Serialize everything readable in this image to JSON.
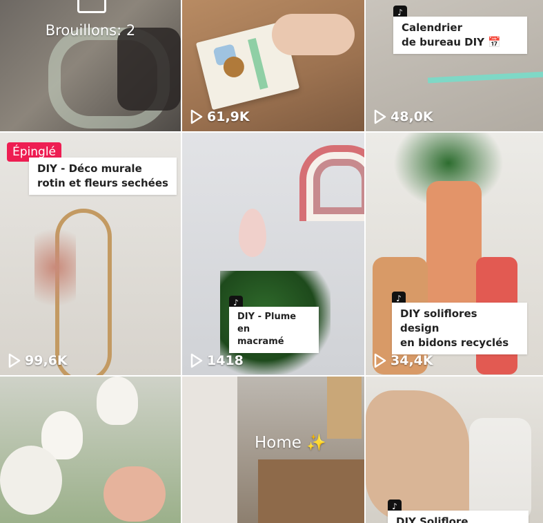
{
  "tiles": [
    {
      "kind": "drafts",
      "text": "Brouillons: 2"
    },
    {
      "kind": "video",
      "views": "61,9K"
    },
    {
      "kind": "video",
      "caption": "Calendrier\nde bureau DIY 📅",
      "views": "48,0K"
    },
    {
      "kind": "video",
      "pinned": "Épinglé",
      "caption": "DIY - Déco murale\nrotin et fleurs sechées",
      "views": "99,6K"
    },
    {
      "kind": "video",
      "caption": "DIY - Plume en\nmacramé",
      "views": "1418"
    },
    {
      "kind": "video",
      "caption": "DIY soliflores design\nen bidons recyclés",
      "views": "34,4K"
    },
    {
      "kind": "video"
    },
    {
      "kind": "video",
      "text": "Home ✨"
    },
    {
      "kind": "video",
      "caption": "DIY Soliflore"
    }
  ],
  "icons": {
    "tiktok": "tiktok-icon",
    "play": "play-icon"
  }
}
